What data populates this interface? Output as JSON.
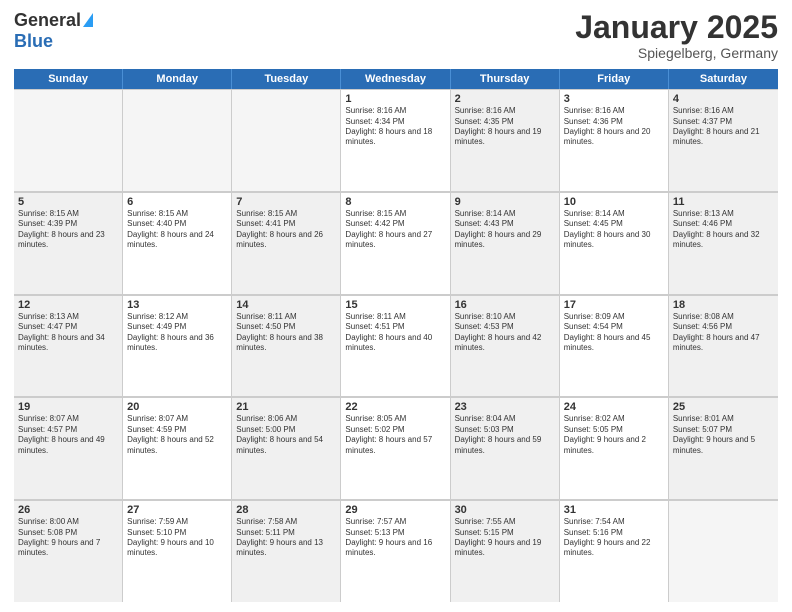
{
  "logo": {
    "general": "General",
    "blue": "Blue"
  },
  "title": "January 2025",
  "subtitle": "Spiegelberg, Germany",
  "days": [
    "Sunday",
    "Monday",
    "Tuesday",
    "Wednesday",
    "Thursday",
    "Friday",
    "Saturday"
  ],
  "rows": [
    [
      {
        "day": "",
        "empty": true
      },
      {
        "day": "",
        "empty": true
      },
      {
        "day": "",
        "empty": true
      },
      {
        "day": "1",
        "sunrise": "Sunrise: 8:16 AM",
        "sunset": "Sunset: 4:34 PM",
        "daylight": "Daylight: 8 hours and 18 minutes."
      },
      {
        "day": "2",
        "sunrise": "Sunrise: 8:16 AM",
        "sunset": "Sunset: 4:35 PM",
        "daylight": "Daylight: 8 hours and 19 minutes."
      },
      {
        "day": "3",
        "sunrise": "Sunrise: 8:16 AM",
        "sunset": "Sunset: 4:36 PM",
        "daylight": "Daylight: 8 hours and 20 minutes."
      },
      {
        "day": "4",
        "sunrise": "Sunrise: 8:16 AM",
        "sunset": "Sunset: 4:37 PM",
        "daylight": "Daylight: 8 hours and 21 minutes."
      }
    ],
    [
      {
        "day": "5",
        "sunrise": "Sunrise: 8:15 AM",
        "sunset": "Sunset: 4:39 PM",
        "daylight": "Daylight: 8 hours and 23 minutes."
      },
      {
        "day": "6",
        "sunrise": "Sunrise: 8:15 AM",
        "sunset": "Sunset: 4:40 PM",
        "daylight": "Daylight: 8 hours and 24 minutes."
      },
      {
        "day": "7",
        "sunrise": "Sunrise: 8:15 AM",
        "sunset": "Sunset: 4:41 PM",
        "daylight": "Daylight: 8 hours and 26 minutes."
      },
      {
        "day": "8",
        "sunrise": "Sunrise: 8:15 AM",
        "sunset": "Sunset: 4:42 PM",
        "daylight": "Daylight: 8 hours and 27 minutes."
      },
      {
        "day": "9",
        "sunrise": "Sunrise: 8:14 AM",
        "sunset": "Sunset: 4:43 PM",
        "daylight": "Daylight: 8 hours and 29 minutes."
      },
      {
        "day": "10",
        "sunrise": "Sunrise: 8:14 AM",
        "sunset": "Sunset: 4:45 PM",
        "daylight": "Daylight: 8 hours and 30 minutes."
      },
      {
        "day": "11",
        "sunrise": "Sunrise: 8:13 AM",
        "sunset": "Sunset: 4:46 PM",
        "daylight": "Daylight: 8 hours and 32 minutes."
      }
    ],
    [
      {
        "day": "12",
        "sunrise": "Sunrise: 8:13 AM",
        "sunset": "Sunset: 4:47 PM",
        "daylight": "Daylight: 8 hours and 34 minutes."
      },
      {
        "day": "13",
        "sunrise": "Sunrise: 8:12 AM",
        "sunset": "Sunset: 4:49 PM",
        "daylight": "Daylight: 8 hours and 36 minutes."
      },
      {
        "day": "14",
        "sunrise": "Sunrise: 8:11 AM",
        "sunset": "Sunset: 4:50 PM",
        "daylight": "Daylight: 8 hours and 38 minutes."
      },
      {
        "day": "15",
        "sunrise": "Sunrise: 8:11 AM",
        "sunset": "Sunset: 4:51 PM",
        "daylight": "Daylight: 8 hours and 40 minutes."
      },
      {
        "day": "16",
        "sunrise": "Sunrise: 8:10 AM",
        "sunset": "Sunset: 4:53 PM",
        "daylight": "Daylight: 8 hours and 42 minutes."
      },
      {
        "day": "17",
        "sunrise": "Sunrise: 8:09 AM",
        "sunset": "Sunset: 4:54 PM",
        "daylight": "Daylight: 8 hours and 45 minutes."
      },
      {
        "day": "18",
        "sunrise": "Sunrise: 8:08 AM",
        "sunset": "Sunset: 4:56 PM",
        "daylight": "Daylight: 8 hours and 47 minutes."
      }
    ],
    [
      {
        "day": "19",
        "sunrise": "Sunrise: 8:07 AM",
        "sunset": "Sunset: 4:57 PM",
        "daylight": "Daylight: 8 hours and 49 minutes."
      },
      {
        "day": "20",
        "sunrise": "Sunrise: 8:07 AM",
        "sunset": "Sunset: 4:59 PM",
        "daylight": "Daylight: 8 hours and 52 minutes."
      },
      {
        "day": "21",
        "sunrise": "Sunrise: 8:06 AM",
        "sunset": "Sunset: 5:00 PM",
        "daylight": "Daylight: 8 hours and 54 minutes."
      },
      {
        "day": "22",
        "sunrise": "Sunrise: 8:05 AM",
        "sunset": "Sunset: 5:02 PM",
        "daylight": "Daylight: 8 hours and 57 minutes."
      },
      {
        "day": "23",
        "sunrise": "Sunrise: 8:04 AM",
        "sunset": "Sunset: 5:03 PM",
        "daylight": "Daylight: 8 hours and 59 minutes."
      },
      {
        "day": "24",
        "sunrise": "Sunrise: 8:02 AM",
        "sunset": "Sunset: 5:05 PM",
        "daylight": "Daylight: 9 hours and 2 minutes."
      },
      {
        "day": "25",
        "sunrise": "Sunrise: 8:01 AM",
        "sunset": "Sunset: 5:07 PM",
        "daylight": "Daylight: 9 hours and 5 minutes."
      }
    ],
    [
      {
        "day": "26",
        "sunrise": "Sunrise: 8:00 AM",
        "sunset": "Sunset: 5:08 PM",
        "daylight": "Daylight: 9 hours and 7 minutes."
      },
      {
        "day": "27",
        "sunrise": "Sunrise: 7:59 AM",
        "sunset": "Sunset: 5:10 PM",
        "daylight": "Daylight: 9 hours and 10 minutes."
      },
      {
        "day": "28",
        "sunrise": "Sunrise: 7:58 AM",
        "sunset": "Sunset: 5:11 PM",
        "daylight": "Daylight: 9 hours and 13 minutes."
      },
      {
        "day": "29",
        "sunrise": "Sunrise: 7:57 AM",
        "sunset": "Sunset: 5:13 PM",
        "daylight": "Daylight: 9 hours and 16 minutes."
      },
      {
        "day": "30",
        "sunrise": "Sunrise: 7:55 AM",
        "sunset": "Sunset: 5:15 PM",
        "daylight": "Daylight: 9 hours and 19 minutes."
      },
      {
        "day": "31",
        "sunrise": "Sunrise: 7:54 AM",
        "sunset": "Sunset: 5:16 PM",
        "daylight": "Daylight: 9 hours and 22 minutes."
      },
      {
        "day": "",
        "empty": true
      }
    ]
  ]
}
